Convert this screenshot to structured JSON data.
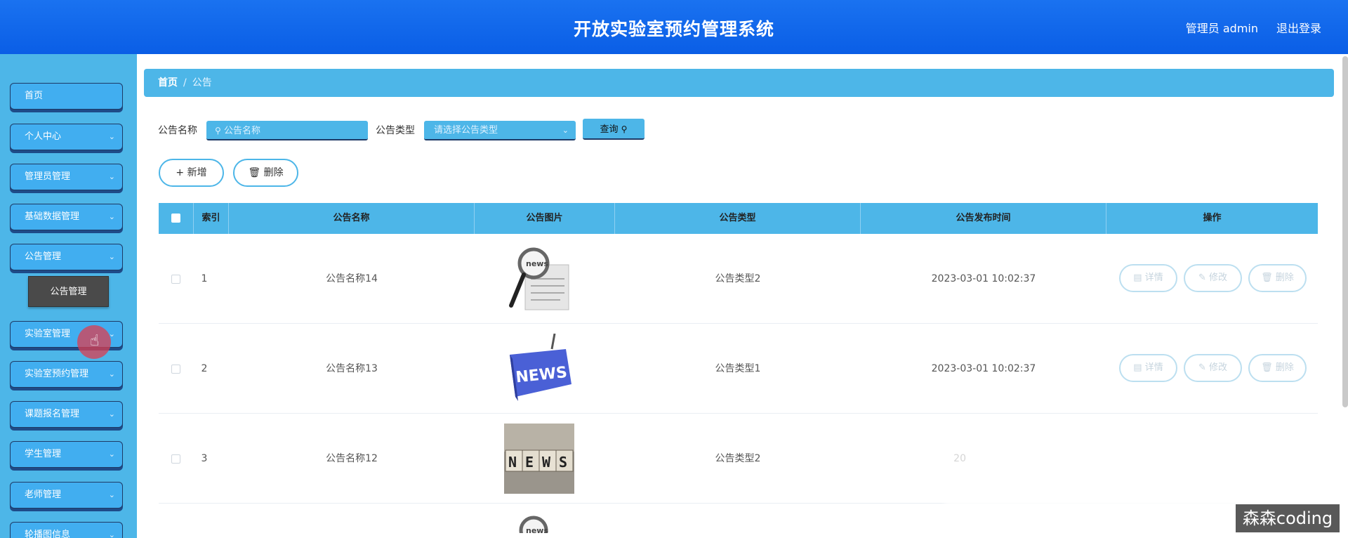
{
  "header": {
    "title": "开放实验室预约管理系统",
    "user": "管理员 admin",
    "logout": "退出登录"
  },
  "sidebar": {
    "items": [
      {
        "label": "首页",
        "has_chevron": false
      },
      {
        "label": "个人中心",
        "has_chevron": true
      },
      {
        "label": "管理员管理",
        "has_chevron": true
      },
      {
        "label": "基础数据管理",
        "has_chevron": true
      },
      {
        "label": "公告管理",
        "has_chevron": true
      },
      {
        "label": "实验室管理",
        "has_chevron": true
      },
      {
        "label": "实验室预约管理",
        "has_chevron": true
      },
      {
        "label": "课题报名管理",
        "has_chevron": true
      },
      {
        "label": "学生管理",
        "has_chevron": true
      },
      {
        "label": "老师管理",
        "has_chevron": true
      },
      {
        "label": "轮播图信息",
        "has_chevron": true
      }
    ],
    "submenu_label": "公告管理"
  },
  "breadcrumb": {
    "home": "首页",
    "sep": "/",
    "current": "公告"
  },
  "filters": {
    "name_label": "公告名称",
    "name_placeholder": "公告名称",
    "type_label": "公告类型",
    "type_placeholder": "请选择公告类型",
    "query_button": "查询"
  },
  "actions": {
    "add": "新增",
    "delete": "删除"
  },
  "table": {
    "columns": [
      "索引",
      "公告名称",
      "公告图片",
      "公告类型",
      "公告发布时间",
      "操作"
    ],
    "rows": [
      {
        "index": "1",
        "name": "公告名称14",
        "type": "公告类型2",
        "time": "2023-03-01 10:02:37",
        "image": "magnifier-news"
      },
      {
        "index": "2",
        "name": "公告名称13",
        "type": "公告类型1",
        "time": "2023-03-01 10:02:37",
        "image": "news-key"
      },
      {
        "index": "3",
        "name": "公告名称12",
        "type": "公告类型2",
        "time": "20",
        "image": "news-cubes"
      }
    ],
    "row_actions": {
      "detail": "详情",
      "edit": "修改",
      "delete": "删除"
    }
  },
  "watermark": "森森coding",
  "colors": {
    "header": "#0a5ee6",
    "accent": "#4db6e8",
    "submenu": "#4a4a4a"
  }
}
